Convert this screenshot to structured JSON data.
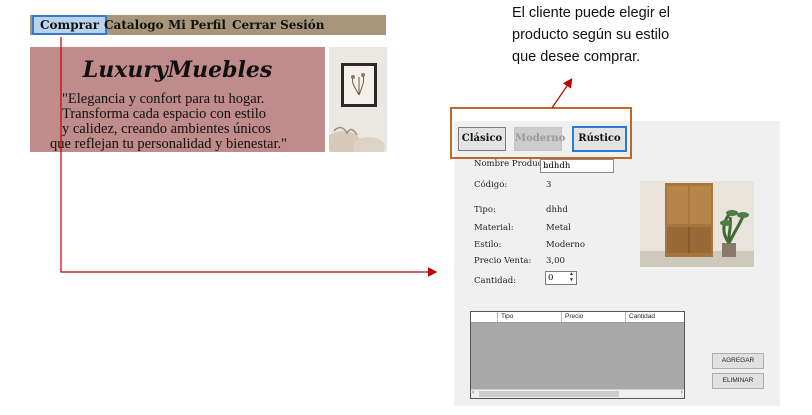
{
  "nav": {
    "items": [
      "Comprar",
      "Catalogo",
      "Mi Perfil",
      "Cerrar Sesión"
    ],
    "active": "Comprar"
  },
  "hero": {
    "title": "LuxuryMuebles",
    "lines": [
      "\"Elegancia y confort para tu hogar.",
      "Transforma cada espacio con estilo",
      "y calidez, creando ambientes únicos",
      "que reflejan tu personalidad y bienestar.\""
    ]
  },
  "annotation": {
    "lines": [
      "El cliente puede elegir el",
      "producto según su estilo",
      "que desee comprar."
    ]
  },
  "style_buttons": {
    "clasico": "Clásico",
    "moderno": "Moderno",
    "rustico": "Rústico",
    "selected": "Rústico",
    "disabled": "Moderno"
  },
  "form": {
    "nombre_label": "Nombre Producto:",
    "nombre_value": "hdhdh",
    "codigo_label": "Código:",
    "codigo_value": "3",
    "tipo_label": "Tipo:",
    "tipo_value": "dhhd",
    "material_label": "Material:",
    "material_value": "Metal",
    "estilo_label": "Estilo:",
    "estilo_value": "Moderno",
    "precio_label": "Precio Venta:",
    "precio_value": "3,00",
    "cantidad_label": "Cantidad:",
    "cantidad_value": "0"
  },
  "grid": {
    "columns": [
      "",
      "Tipo",
      "Precio",
      "Cantidad"
    ]
  },
  "actions": {
    "agregar": "AGREGAR",
    "eliminar": "ELIMINAR"
  },
  "colors": {
    "nav_bg": "#a8967a",
    "hero_bg": "#c08b8b",
    "highlight_border": "#c0672a",
    "arrow": "#c00000",
    "selected_border": "#2b7bd6"
  }
}
